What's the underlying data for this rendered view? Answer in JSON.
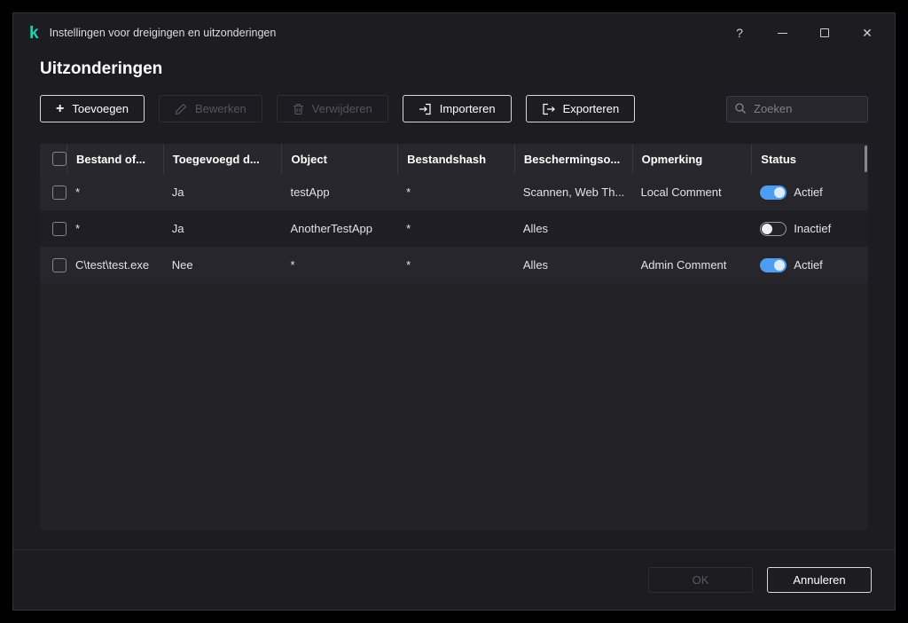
{
  "titlebar": {
    "title": "Instellingen voor dreigingen en uitzonderingen"
  },
  "icons": {
    "logo": "k",
    "plus": "+",
    "help": "?",
    "close": "✕"
  },
  "page": {
    "title": "Uitzonderingen"
  },
  "toolbar": {
    "add": "Toevoegen",
    "edit": "Bewerken",
    "delete": "Verwijderen",
    "import": "Importeren",
    "export": "Exporteren",
    "search_placeholder": "Zoeken"
  },
  "table": {
    "columns": [
      "Bestand of...",
      "Toegevoegd d...",
      "Object",
      "Bestandshash",
      "Beschermingso...",
      "Opmerking",
      "Status"
    ],
    "rows": [
      {
        "file": "*",
        "added": "Ja",
        "object": "testApp",
        "hash": "*",
        "protection": "Scannen, Web Th...",
        "comment": "Local Comment",
        "status": "Actief",
        "enabled": true
      },
      {
        "file": "*",
        "added": "Ja",
        "object": "AnotherTestApp",
        "hash": "*",
        "protection": "Alles",
        "comment": "",
        "status": "Inactief",
        "enabled": false
      },
      {
        "file": "C\\test\\test.exe",
        "added": "Nee",
        "object": "*",
        "hash": "*",
        "protection": "Alles",
        "comment": "Admin Comment",
        "status": "Actief",
        "enabled": true
      }
    ]
  },
  "footer": {
    "ok": "OK",
    "cancel": "Annuleren"
  },
  "colors": {
    "brand_green": "#23d1ae",
    "toggle_on": "#4d9df0",
    "window_bg": "#1c1c21",
    "accent_border": "#d9d9dc"
  }
}
